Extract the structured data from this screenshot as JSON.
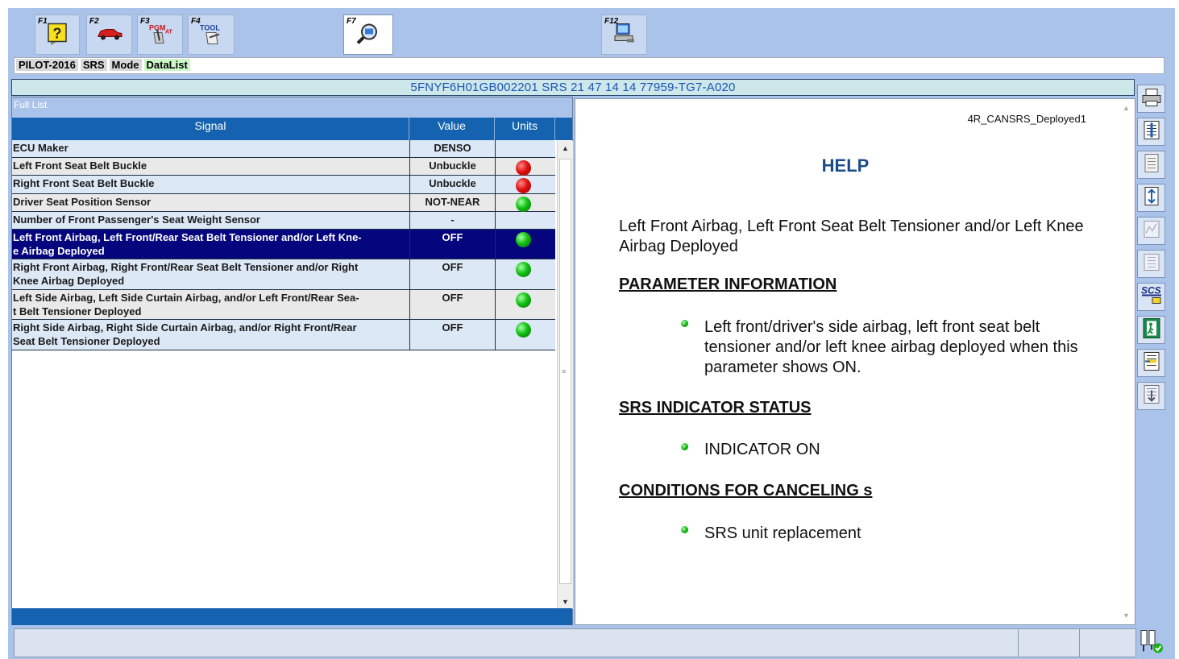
{
  "toolbar": {
    "keys": [
      {
        "label": "F1",
        "icon": "help-icon"
      },
      {
        "label": "F2",
        "icon": "car-icon"
      },
      {
        "label": "F3",
        "icon": "pgm-fi-at-icon"
      },
      {
        "label": "F4",
        "icon": "tool-icon"
      },
      {
        "label": "F7",
        "icon": "magnifier-icon"
      },
      {
        "label": "F12",
        "icon": "computer-icon"
      }
    ],
    "f3_icon_text": "PGM/AT",
    "f4_icon_text": "TOOL"
  },
  "breadcrumb": {
    "model": "PILOT-2016",
    "system": "SRS",
    "mode": "Mode",
    "view": "DataList"
  },
  "vin_bar": "5FNYF6H01GB002201  SRS  21 47 14 14  77959-TG7-A020",
  "list": {
    "title": "Full List",
    "columns": [
      "Signal",
      "Value",
      "Units"
    ],
    "rows": [
      {
        "signal": "ECU Maker",
        "value": "DENSO",
        "unit_indicator": "none"
      },
      {
        "signal": "Left Front Seat Belt Buckle",
        "value": "Unbuckle",
        "unit_indicator": "red"
      },
      {
        "signal": "Right Front Seat Belt Buckle",
        "value": "Unbuckle",
        "unit_indicator": "red"
      },
      {
        "signal": "Driver Seat Position Sensor",
        "value": "NOT-NEAR",
        "unit_indicator": "green"
      },
      {
        "signal": "Number of Front Passenger's Seat Weight Sensor",
        "value": "-",
        "unit_indicator": "none"
      },
      {
        "signal": "Left Front Airbag, Left Front/Rear Seat Belt Tensioner and/or Left Kne-\ne Airbag Deployed",
        "value": "OFF",
        "unit_indicator": "green"
      },
      {
        "signal": "Right Front Airbag, Right Front/Rear Seat Belt Tensioner and/or Right\n Knee Airbag Deployed",
        "value": "OFF",
        "unit_indicator": "green"
      },
      {
        "signal": "Left Side Airbag, Left Side Curtain Airbag, and/or Left Front/Rear Sea-\nt Belt Tensioner Deployed",
        "value": "OFF",
        "unit_indicator": "green"
      },
      {
        "signal": "Right Side Airbag, Right Side Curtain Airbag, and/or Right Front/Rear\n Seat Belt Tensioner Deployed",
        "value": "OFF",
        "unit_indicator": "green"
      }
    ],
    "selected_row": 5
  },
  "help": {
    "id": "4R_CANSRS_Deployed1",
    "title": "HELP",
    "name": "Left Front Airbag, Left Front Seat Belt Tensioner and/or Left Knee Airbag Deployed",
    "sections": [
      {
        "heading": "PARAMETER INFORMATION",
        "bullets": [
          "Left front/driver's side airbag, left front seat belt tensioner and/or left knee airbag deployed when this parameter shows ON."
        ]
      },
      {
        "heading": "SRS INDICATOR STATUS",
        "bullets": [
          "INDICATOR ON"
        ]
      },
      {
        "heading": "CONDITIONS FOR CANCELING s",
        "bullets": [
          "SRS unit replacement"
        ]
      }
    ]
  },
  "side_tools": [
    {
      "icon": "printer-icon"
    },
    {
      "icon": "data-select-icon"
    },
    {
      "icon": "list-view-icon"
    },
    {
      "icon": "sort-icon"
    },
    {
      "icon": "graph-icon"
    },
    {
      "icon": "snapshot-icon"
    },
    {
      "icon": "scs-icon",
      "text": "SCS"
    },
    {
      "icon": "exit-icon"
    },
    {
      "icon": "list-edit-icon"
    },
    {
      "icon": "download-list-icon"
    }
  ],
  "colors": {
    "frame": "#a9c3ea",
    "header_blue": "#1563b0",
    "selected_row": "#05057e",
    "help_title": "#1b4e88"
  }
}
